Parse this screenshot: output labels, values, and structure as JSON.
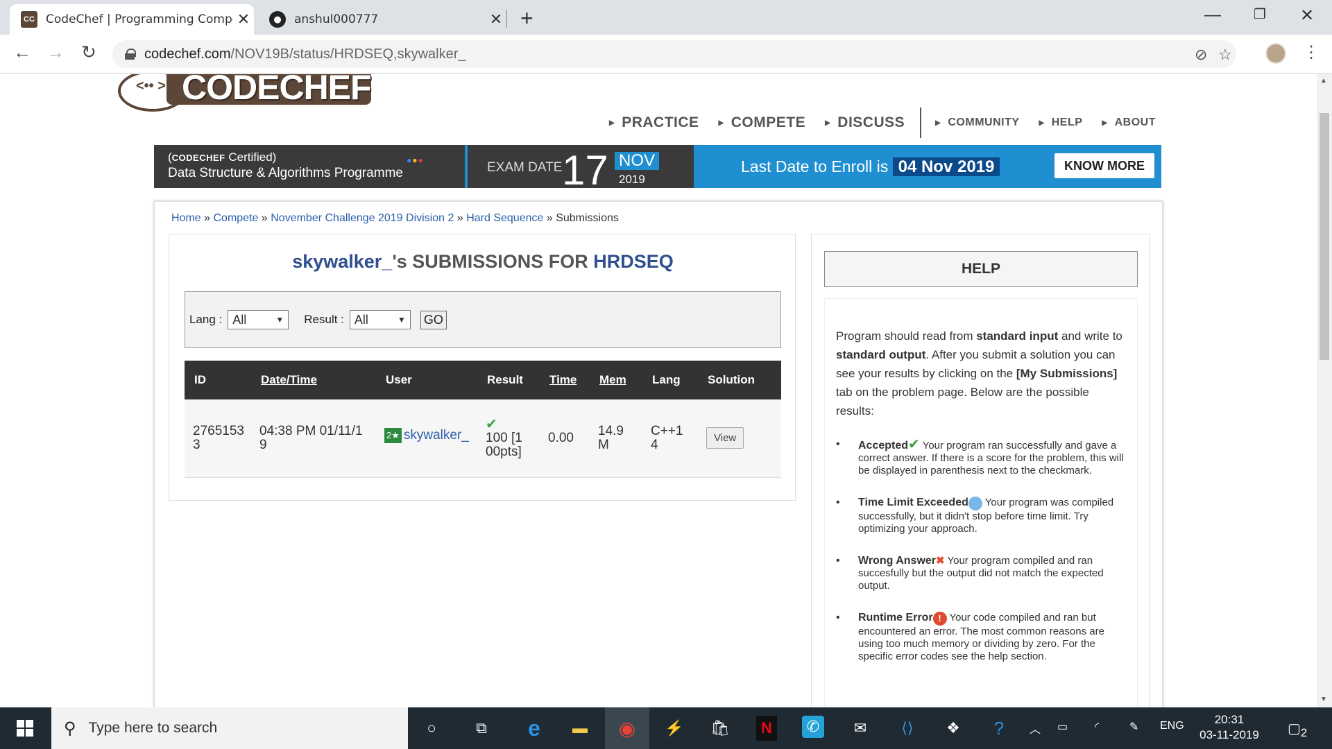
{
  "browser": {
    "tabs": [
      {
        "title": "CodeChef | Programming Compe",
        "favicon": "codechef-icon"
      },
      {
        "title": "anshul000777",
        "favicon": "github-icon"
      }
    ],
    "url_host": "codechef.com",
    "url_path": "/NOV19B/status/HRDSEQ,skywalker_"
  },
  "header": {
    "logo_text": "CODECHEF",
    "nav_big": [
      "PRACTICE",
      "COMPETE",
      "DISCUSS"
    ],
    "nav_small": [
      "COMMUNITY",
      "HELP",
      "ABOUT"
    ]
  },
  "banner": {
    "cert_brand": "CODECHEF",
    "cert_word": "Certified",
    "program": "Data Structure & Algorithms Programme",
    "exam_label": "EXAM DATE",
    "exam_day": "17",
    "exam_month": "NOV",
    "exam_year": "2019",
    "enroll_text": "Last Date to Enroll is",
    "enroll_date": "04 Nov 2019",
    "cta": "KNOW MORE"
  },
  "breadcrumb": {
    "items": [
      "Home",
      "Compete",
      "November Challenge 2019 Division 2",
      "Hard Sequence"
    ],
    "current": "Submissions",
    "sep": "»"
  },
  "submissions": {
    "user": "skywalker_",
    "title_rest": "'s SUBMISSIONS FOR",
    "problem": "HRDSEQ",
    "lang_label": "Lang :",
    "lang_value": "All",
    "result_label": "Result :",
    "result_value": "All",
    "go_label": "GO",
    "columns": [
      "ID",
      "Date/Time",
      "User",
      "Result",
      "Time",
      "Mem",
      "Lang",
      "Solution"
    ],
    "rows": [
      {
        "id": "27651533",
        "datetime": "04:38 PM 01/11/19",
        "user_badge": "2★",
        "user": "skywalker_",
        "result": "100 [100pts]",
        "time": "0.00",
        "mem": "14.9M",
        "lang": "C++14",
        "solution": "View"
      }
    ]
  },
  "help": {
    "heading": "HELP",
    "intro_1": "Program should read from ",
    "intro_b1": "standard input",
    "intro_2": " and write to ",
    "intro_b2": "standard output",
    "intro_3": ". After you submit a solution you can see your results by clicking on the ",
    "intro_b3": "[My Submissions]",
    "intro_4": " tab on the problem page. Below are the possible results:",
    "items": [
      {
        "term": "Accepted",
        "icon": "check-icon",
        "desc": " Your program ran successfully and gave a correct answer. If there is a score for the problem, this will be displayed in parenthesis next to the checkmark."
      },
      {
        "term": "Time Limit Exceeded",
        "icon": "clock-icon",
        "desc": " Your program was compiled successfully, but it didn't stop before time limit. Try optimizing your approach."
      },
      {
        "term": "Wrong Answer",
        "icon": "cross-icon",
        "desc": " Your program compiled and ran succesfully but the output did not match the expected output."
      },
      {
        "term": "Runtime Error",
        "icon": "error-icon",
        "desc": " Your code compiled and ran but encountered an error. The most common reasons are using too much memory or dividing by zero. For the specific error codes see the help section."
      }
    ]
  },
  "taskbar": {
    "search_placeholder": "Type here to search",
    "lang": "ENG",
    "time": "20:31",
    "date": "03-11-2019",
    "notifications": "2"
  }
}
